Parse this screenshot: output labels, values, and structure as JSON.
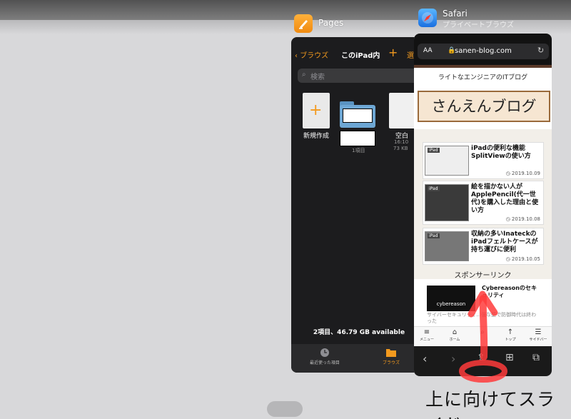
{
  "pages_app": {
    "name": "Pages",
    "nav": {
      "back": "ブラウズ",
      "title": "このiPad内",
      "add": "+",
      "select": "選"
    },
    "search_placeholder": "検索",
    "tiles": [
      {
        "label": "新規作成"
      },
      {
        "meta": "1項目"
      },
      {
        "label": "空白",
        "time": "16:10",
        "size": "73 KB"
      }
    ],
    "footer": "2項目、46.79 GB available",
    "tabbar": [
      {
        "label": "最近使った項目"
      },
      {
        "label": "ブラウズ"
      }
    ]
  },
  "safari_app": {
    "name": "Safari",
    "subtitle": "プライベートブラウズ",
    "url": {
      "aa": "AA",
      "domain": "sanen-blog.com"
    },
    "blog": {
      "tagline": "ライトなエンジニアのITブログ",
      "logo": "さんえんブログ",
      "posts": [
        {
          "badge": "iPad",
          "title": "iPadの便利な機能SplitViewの使い方",
          "date": "◷ 2019.10.09"
        },
        {
          "badge": "iPad",
          "title": "絵を描かない人がApplePencil(代一世代)を購入した理由と使い方",
          "date": "◷ 2019.10.08"
        },
        {
          "badge": "iPad",
          "title": "収納の多いInateckのiPadフェルトケースが持ち運びに便利",
          "date": "◷ 2019.10.05"
        }
      ],
      "sponsor": "スポンサーリンク",
      "ad": {
        "brand": "cybereason",
        "title": "Cybereasonのセキュリティ",
        "desc": "サイバーセキュリティ...強な壁で防御時代は終わった"
      }
    },
    "bottom_nav": [
      {
        "label": "メニュー",
        "icon": "menu-icon"
      },
      {
        "label": "ホーム",
        "icon": "home-icon"
      },
      {
        "label": "",
        "icon": "search-icon"
      },
      {
        "label": "トップ",
        "icon": "arrow-up-icon"
      },
      {
        "label": "サイドバー",
        "icon": "sidebar-icon"
      }
    ],
    "toolbar": [
      "back-icon",
      "forward-icon",
      "share-icon",
      "bookmarks-icon",
      "tabs-icon"
    ]
  },
  "annotation": {
    "text": "上に向けてスライド",
    "color": "#ff3b3b"
  }
}
